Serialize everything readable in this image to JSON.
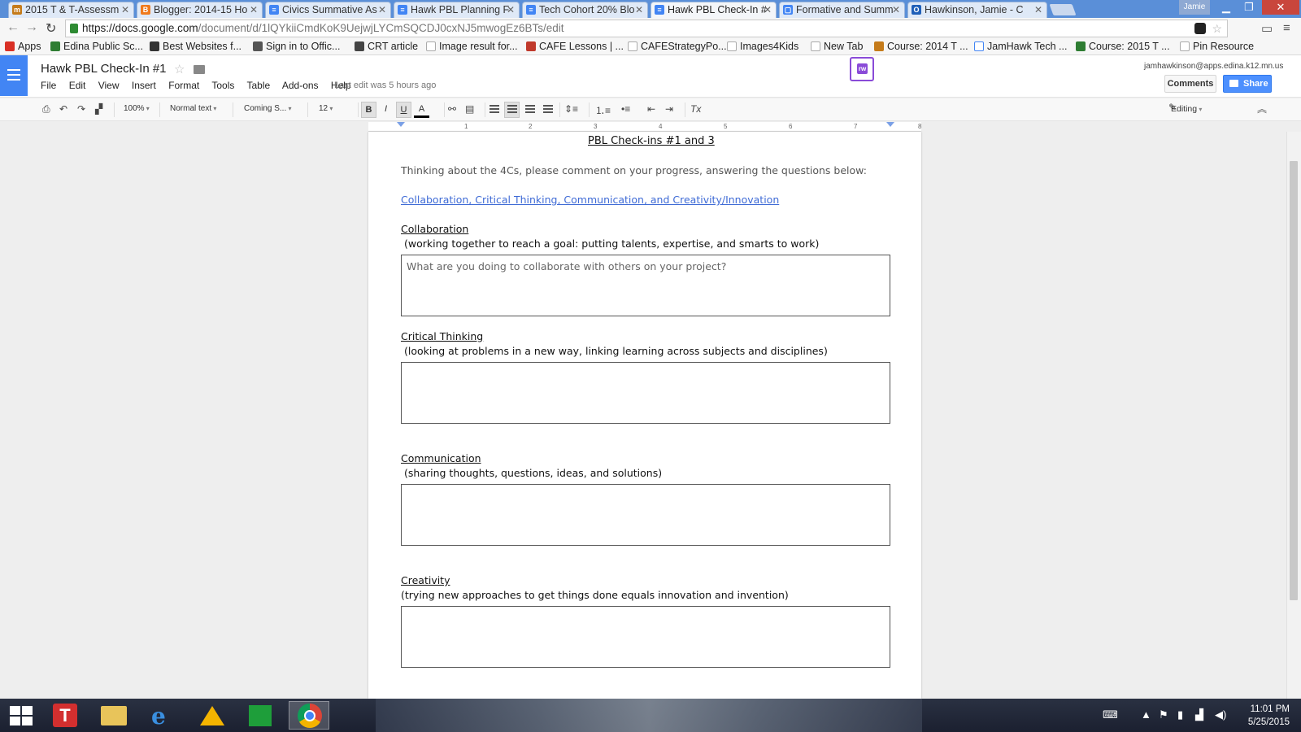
{
  "browser": {
    "tabs": [
      {
        "label": "2015 T & T-Assessm",
        "fav_color": "#c57b1a",
        "fav_glyph": "m"
      },
      {
        "label": "Blogger: 2014-15 Ho",
        "fav_color": "#f07a1c",
        "fav_glyph": "B"
      },
      {
        "label": "Civics Summative As",
        "fav_color": "#4285f4",
        "fav_glyph": "≡"
      },
      {
        "label": "Hawk PBL Planning F",
        "fav_color": "#4285f4",
        "fav_glyph": "≡"
      },
      {
        "label": "Tech Cohort 20% Blo",
        "fav_color": "#4285f4",
        "fav_glyph": "≡"
      },
      {
        "label": "Hawk PBL Check-In #",
        "fav_color": "#4285f4",
        "fav_glyph": "≡",
        "active": true
      },
      {
        "label": "Formative and Summ",
        "fav_color": "#4285f4",
        "fav_glyph": "▢"
      },
      {
        "label": "Hawkinson, Jamie - C",
        "fav_color": "#1f5fb8",
        "fav_glyph": "O"
      }
    ],
    "profile_label": "Jamie",
    "url_host": "https://docs.google.com",
    "url_path": "/document/d/1lQYkiiCmdKoK9UejwjLYCmSQCDJ0cxNJ5mwogEz6BTs/edit",
    "bookmarks": [
      {
        "label": "Apps",
        "icon_color": "#d93025"
      },
      {
        "label": "Edina Public Sc...",
        "icon_color": "#2e7d32"
      },
      {
        "label": "Best Websites f...",
        "icon_color": "#333333"
      },
      {
        "label": "Sign in to Offic...",
        "icon_color": "#555555"
      },
      {
        "label": "CRT article",
        "icon_color": "#444444"
      },
      {
        "label": "Image result for...",
        "icon_color": "#dddddd"
      },
      {
        "label": "CAFE Lessons | ...",
        "icon_color": "#c0392b"
      },
      {
        "label": "CAFEStrategyPo...",
        "icon_color": "#dddddd"
      },
      {
        "label": "Images4Kids",
        "icon_color": "#dddddd"
      },
      {
        "label": "New Tab",
        "icon_color": "#dddddd"
      },
      {
        "label": "Course: 2014 T ...",
        "icon_color": "#c57b1a"
      },
      {
        "label": "JamHawk Tech ...",
        "icon_color": "#4285f4"
      },
      {
        "label": "Course: 2015 T ...",
        "icon_color": "#2e7d32"
      },
      {
        "label": "Pin Resource",
        "icon_color": "#dddddd"
      }
    ]
  },
  "docs": {
    "title": "Hawk PBL Check-In #1",
    "menu": [
      "File",
      "Edit",
      "View",
      "Insert",
      "Format",
      "Tools",
      "Table",
      "Add-ons",
      "Help"
    ],
    "last_edit": "Last edit was 5 hours ago",
    "user_email": "jamhawkinson@apps.edina.k12.mn.us",
    "comments_label": "Comments",
    "share_label": "Share",
    "addon_badge": "rw",
    "toolbar": {
      "zoom": "100%",
      "style": "Normal text",
      "font": "Coming S...",
      "size": "12",
      "bold": "B",
      "italic": "I",
      "underline": "U",
      "text_color": "A",
      "clear_format": "Tx",
      "mode": "Editing"
    },
    "ruler_ticks": [
      "1",
      "1",
      "2",
      "3",
      "4",
      "5",
      "6",
      "7",
      "8"
    ]
  },
  "document": {
    "heading": "PBL Check-ins #1 and 3",
    "intro": "Thinking about the 4Cs, please comment on your progress, answering the questions below:",
    "link": "Collaboration, Critical Thinking, Communication, and Creativity/Innovation",
    "sections": [
      {
        "title": "Collaboration",
        "desc": "(working together to reach a goal: putting talents, expertise, and smarts to work)",
        "placeholder": "What are you doing to collaborate with others on your project?"
      },
      {
        "title": "Critical Thinking",
        "desc": "(looking at problems in a new way, linking learning across subjects and disciplines)",
        "placeholder": ""
      },
      {
        "title": "Communication",
        "desc": "(sharing thoughts, questions, ideas, and solutions)",
        "placeholder": ""
      },
      {
        "title": "Creativity",
        "desc": "(trying new approaches to get things done equals innovation and invention)",
        "placeholder": ""
      }
    ]
  },
  "taskbar": {
    "time": "11:01 PM",
    "date": "5/25/2015"
  }
}
